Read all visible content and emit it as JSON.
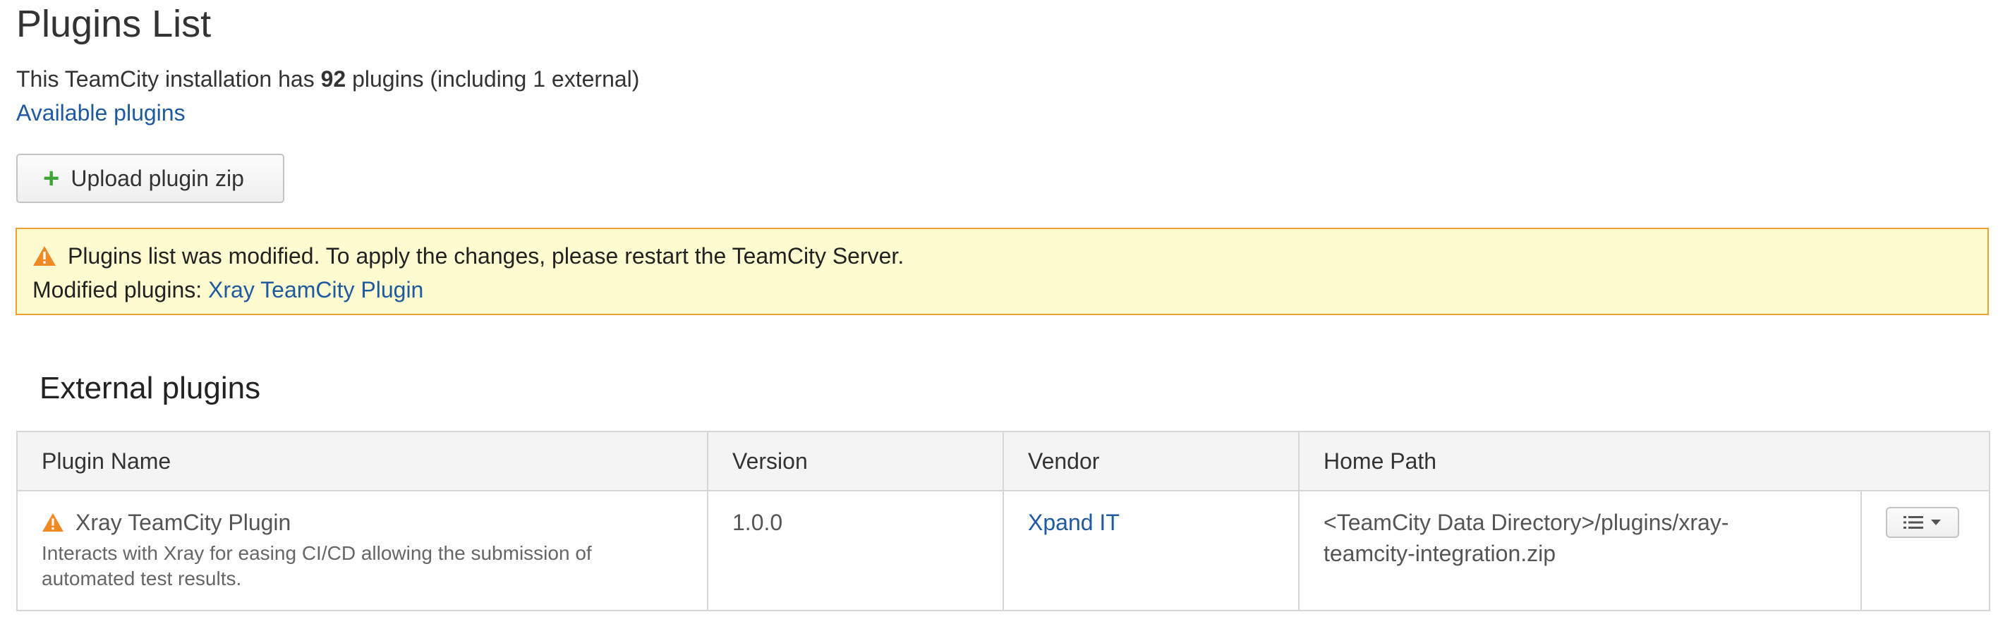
{
  "page": {
    "title": "Plugins List",
    "summary_prefix": "This TeamCity installation has ",
    "plugin_count": "92",
    "summary_suffix": " plugins (including 1 external)",
    "available_link": "Available plugins"
  },
  "upload_button": {
    "icon": "plus-icon",
    "label": "Upload plugin zip"
  },
  "warning": {
    "icon": "warning-triangle-icon",
    "message": "Plugins list was modified. To apply the changes, please restart the TeamCity Server.",
    "modified_label": "Modified plugins: ",
    "modified_plugin": "Xray TeamCity Plugin"
  },
  "external": {
    "section_title": "External plugins",
    "columns": [
      "Plugin Name",
      "Version",
      "Vendor",
      "Home Path"
    ],
    "rows": [
      {
        "name": "Xray TeamCity Plugin",
        "description": "Interacts with Xray for easing CI/CD allowing the submission of automated test results.",
        "version": "1.0.0",
        "vendor": "Xpand IT",
        "home_path": "<TeamCity Data Directory>/plugins/xray-teamcity-integration.zip",
        "status_icon": "warning-triangle-icon",
        "actions_icon": "list-menu-icon"
      }
    ]
  },
  "colors": {
    "link": "#1e5aa0",
    "warning_background": "#fefcd0",
    "warning_border": "#f0a030",
    "warning_icon": "#f08a24",
    "plus_icon": "#3fa535",
    "table_header_background": "#f4f4f4"
  }
}
